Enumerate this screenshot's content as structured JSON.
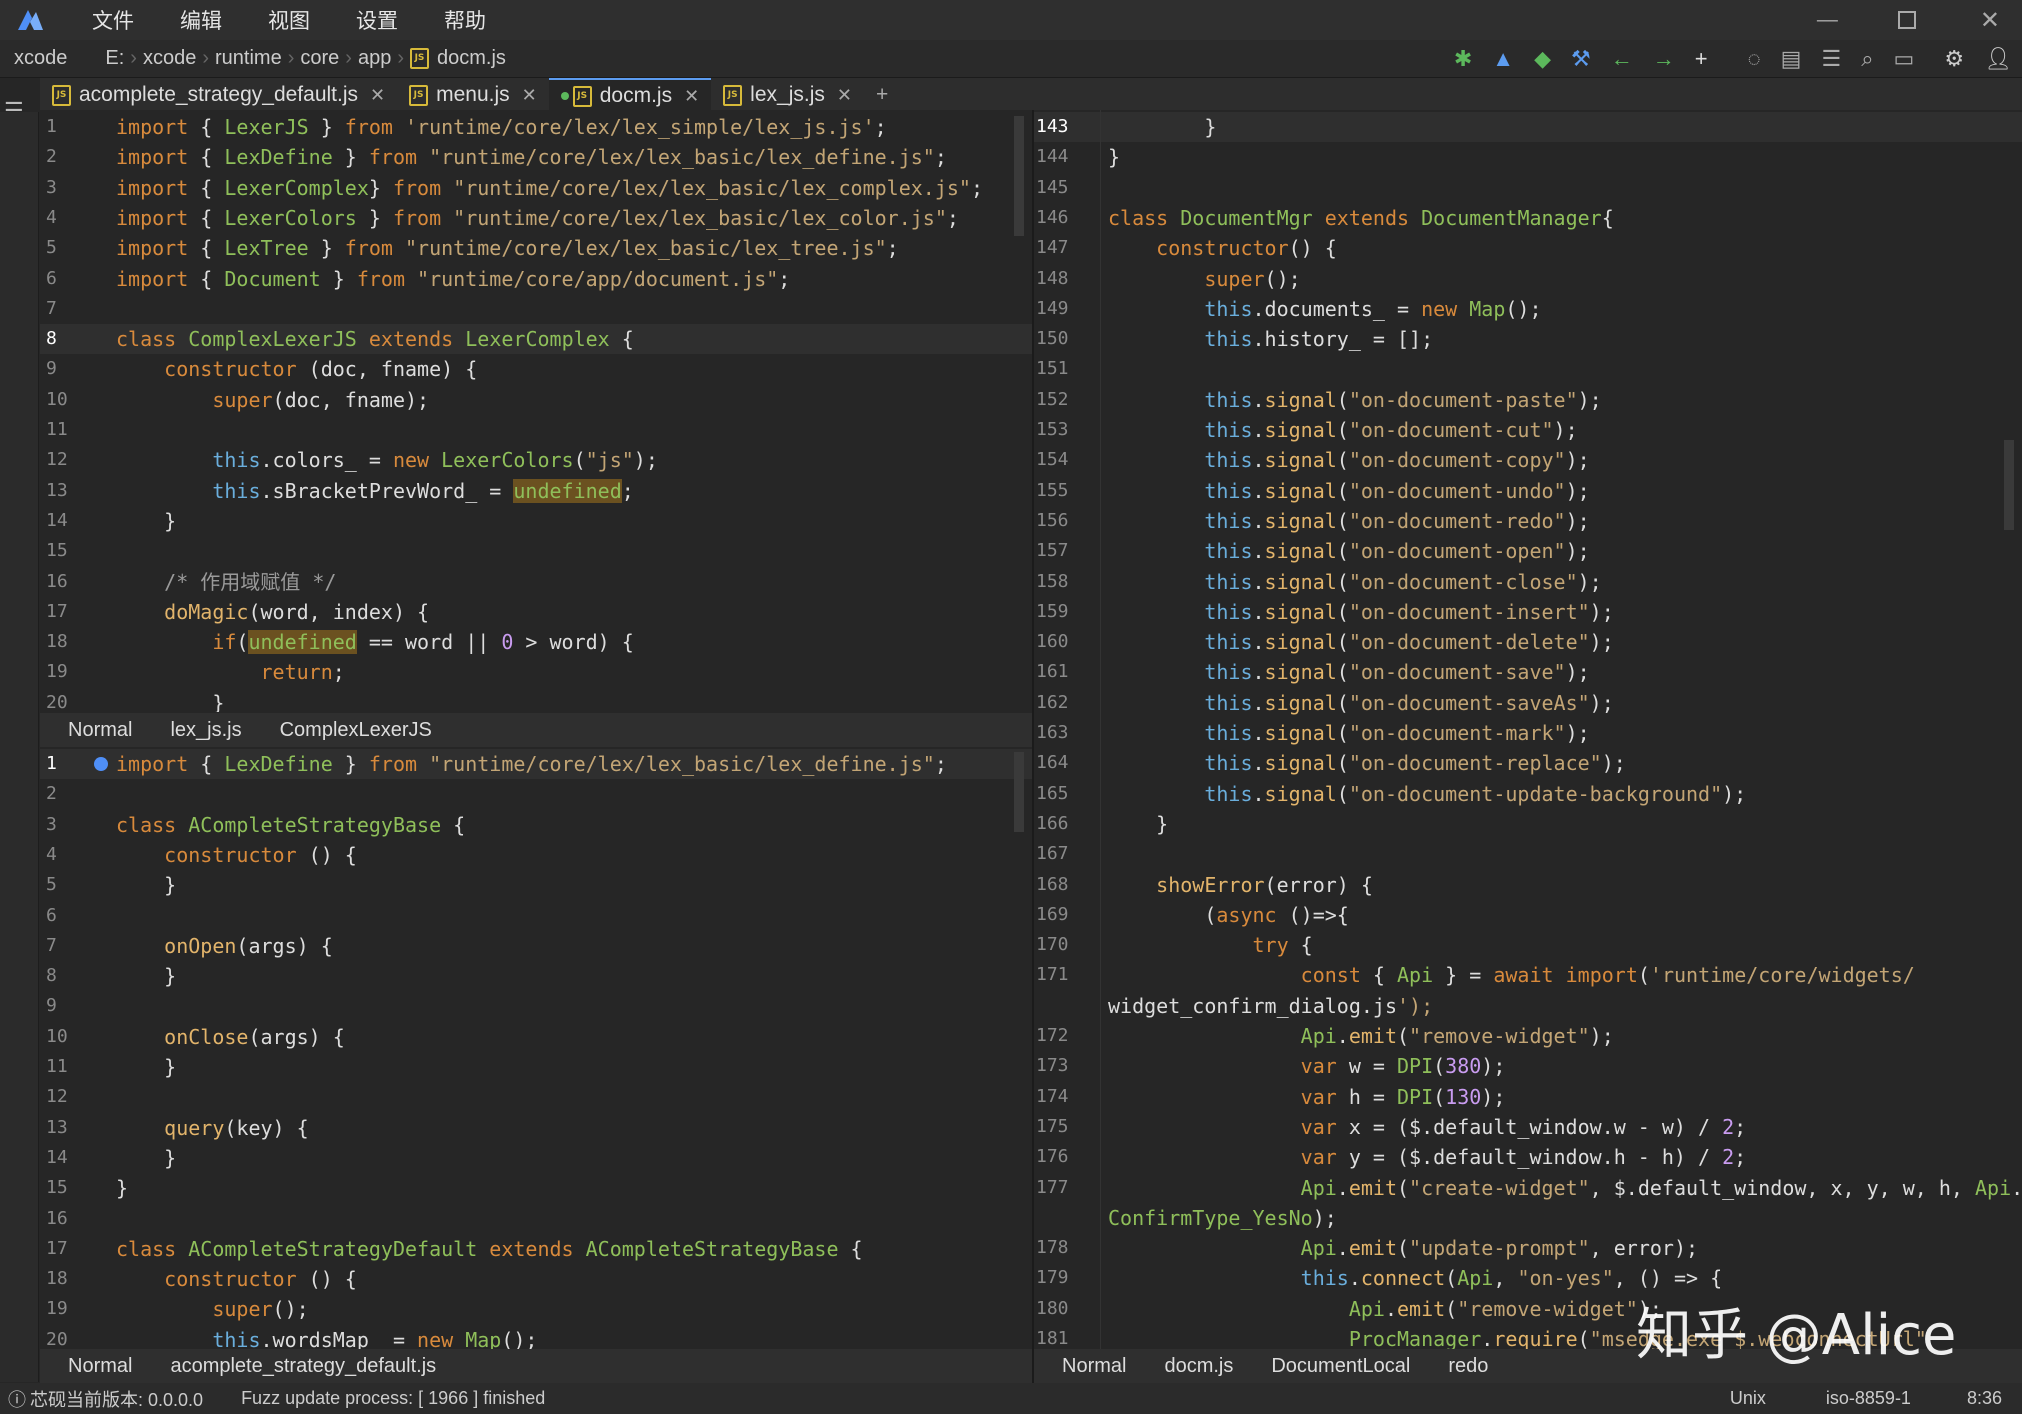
{
  "menubar": {
    "items": [
      "文件",
      "编辑",
      "视图",
      "设置",
      "帮助"
    ]
  },
  "path": {
    "items": [
      "xcode",
      "E:",
      "xcode",
      "runtime",
      "core",
      "app",
      "docm.js"
    ]
  },
  "tabs": [
    {
      "label": "acomplete_strategy_default.js"
    },
    {
      "label": "menu.js"
    },
    {
      "label": "docm.js"
    },
    {
      "label": "lex_js.js"
    }
  ],
  "tab_add": "+",
  "status_tl": {
    "mode": "Normal",
    "file": "lex_js.js",
    "context": "ComplexLexerJS"
  },
  "status_bl": {
    "mode": "Normal",
    "file": "acomplete_strategy_default.js"
  },
  "status_r": {
    "mode": "Normal",
    "file": "docm.js",
    "context": "DocumentLocal",
    "func": "redo"
  },
  "bottom": {
    "version": "芯砚当前版本: 0.0.0.0",
    "process": "Fuzz update process: [ 1966 ] finished",
    "eol": "Unix",
    "encoding": "iso-8859-1",
    "time": "8:36"
  },
  "watermark": "知乎 @Alice",
  "colors": {
    "keyword": "#d88a3c",
    "type": "#8fbf5a",
    "string": "#c3a575",
    "this": "#6aaedc",
    "function": "#e2b46b"
  },
  "pane_tl": [
    {
      "n": "1",
      "t": "import { LexerJS } from 'runtime/core/lex/lex_simple/lex_js.js';"
    },
    {
      "n": "2",
      "t": "import { LexDefine } from \"runtime/core/lex/lex_basic/lex_define.js\";"
    },
    {
      "n": "3",
      "t": "import { LexerComplex} from \"runtime/core/lex/lex_basic/lex_complex.js\";"
    },
    {
      "n": "4",
      "t": "import { LexerColors } from \"runtime/core/lex/lex_basic/lex_color.js\";"
    },
    {
      "n": "5",
      "t": "import { LexTree } from \"runtime/core/lex/lex_basic/lex_tree.js\";"
    },
    {
      "n": "6",
      "t": "import { Document } from \"runtime/core/app/document.js\";"
    },
    {
      "n": "7",
      "t": ""
    },
    {
      "n": "8",
      "t": "class ComplexLexerJS extends LexerComplex {"
    },
    {
      "n": "9",
      "t": "    constructor (doc, fname) {"
    },
    {
      "n": "10",
      "t": "        super(doc, fname);"
    },
    {
      "n": "11",
      "t": ""
    },
    {
      "n": "12",
      "t": "        this.colors_ = new LexerColors(\"js\");"
    },
    {
      "n": "13",
      "t": "        this.sBracketPrevWord_ = undefined;"
    },
    {
      "n": "14",
      "t": "    }"
    },
    {
      "n": "15",
      "t": ""
    },
    {
      "n": "16",
      "t": "    /* 作用域赋值 */"
    },
    {
      "n": "17",
      "t": "    doMagic(word, index) {"
    },
    {
      "n": "18",
      "t": "        if(undefined == word || 0 > word) {"
    },
    {
      "n": "19",
      "t": "            return;"
    },
    {
      "n": "20",
      "t": "        }"
    }
  ],
  "pane_bl": [
    {
      "n": "1",
      "t": "import { LexDefine } from \"runtime/core/lex/lex_basic/lex_define.js\";"
    },
    {
      "n": "2",
      "t": ""
    },
    {
      "n": "3",
      "t": "class ACompleteStrategyBase {"
    },
    {
      "n": "4",
      "t": "    constructor () {"
    },
    {
      "n": "5",
      "t": "    }"
    },
    {
      "n": "6",
      "t": ""
    },
    {
      "n": "7",
      "t": "    onOpen(args) {"
    },
    {
      "n": "8",
      "t": "    }"
    },
    {
      "n": "9",
      "t": ""
    },
    {
      "n": "10",
      "t": "    onClose(args) {"
    },
    {
      "n": "11",
      "t": "    }"
    },
    {
      "n": "12",
      "t": ""
    },
    {
      "n": "13",
      "t": "    query(key) {"
    },
    {
      "n": "14",
      "t": "    }"
    },
    {
      "n": "15",
      "t": "}"
    },
    {
      "n": "16",
      "t": ""
    },
    {
      "n": "17",
      "t": "class ACompleteStrategyDefault extends ACompleteStrategyBase {"
    },
    {
      "n": "18",
      "t": "    constructor () {"
    },
    {
      "n": "19",
      "t": "        super();"
    },
    {
      "n": "20",
      "t": "        this.wordsMap_ = new Map();"
    }
  ],
  "pane_r": [
    {
      "n": "143",
      "t": "        }"
    },
    {
      "n": "144",
      "t": "}"
    },
    {
      "n": "145",
      "t": ""
    },
    {
      "n": "146",
      "t": "class DocumentMgr extends DocumentManager{"
    },
    {
      "n": "147",
      "t": "    constructor() {"
    },
    {
      "n": "148",
      "t": "        super();"
    },
    {
      "n": "149",
      "t": "        this.documents_ = new Map();"
    },
    {
      "n": "150",
      "t": "        this.history_ = [];"
    },
    {
      "n": "151",
      "t": ""
    },
    {
      "n": "152",
      "t": "        this.signal(\"on-document-paste\");"
    },
    {
      "n": "153",
      "t": "        this.signal(\"on-document-cut\");"
    },
    {
      "n": "154",
      "t": "        this.signal(\"on-document-copy\");"
    },
    {
      "n": "155",
      "t": "        this.signal(\"on-document-undo\");"
    },
    {
      "n": "156",
      "t": "        this.signal(\"on-document-redo\");"
    },
    {
      "n": "157",
      "t": "        this.signal(\"on-document-open\");"
    },
    {
      "n": "158",
      "t": "        this.signal(\"on-document-close\");"
    },
    {
      "n": "159",
      "t": "        this.signal(\"on-document-insert\");"
    },
    {
      "n": "160",
      "t": "        this.signal(\"on-document-delete\");"
    },
    {
      "n": "161",
      "t": "        this.signal(\"on-document-save\");"
    },
    {
      "n": "162",
      "t": "        this.signal(\"on-document-saveAs\");"
    },
    {
      "n": "163",
      "t": "        this.signal(\"on-document-mark\");"
    },
    {
      "n": "164",
      "t": "        this.signal(\"on-document-replace\");"
    },
    {
      "n": "165",
      "t": "        this.signal(\"on-document-update-background\");"
    },
    {
      "n": "166",
      "t": "    }"
    },
    {
      "n": "167",
      "t": ""
    },
    {
      "n": "168",
      "t": "    showError(error) {"
    },
    {
      "n": "169",
      "t": "        (async ()=>{"
    },
    {
      "n": "170",
      "t": "            try {"
    },
    {
      "n": "171",
      "t": "                const { Api } = await import('runtime/core/widgets/"
    },
    {
      "n": "",
      "t": "widget_confirm_dialog.js');"
    },
    {
      "n": "172",
      "t": "                Api.emit(\"remove-widget\");"
    },
    {
      "n": "173",
      "t": "                var w = DPI(380);"
    },
    {
      "n": "174",
      "t": "                var h = DPI(130);"
    },
    {
      "n": "175",
      "t": "                var x = ($.default_window.w - w) / 2;"
    },
    {
      "n": "176",
      "t": "                var y = ($.default_window.h - h) / 2;"
    },
    {
      "n": "177",
      "t": "                Api.emit(\"create-widget\", $.default_window, x, y, w, h, Api."
    },
    {
      "n": "",
      "t": "ConfirmType_YesNo);"
    },
    {
      "n": "178",
      "t": "                Api.emit(\"update-prompt\", error);"
    },
    {
      "n": "179",
      "t": "                this.connect(Api, \"on-yes\", () => {"
    },
    {
      "n": "180",
      "t": "                    Api.emit(\"remove-widget\");"
    },
    {
      "n": "181",
      "t": "                    ProcManager.require(\"msedge.exe $.webconnectUrl\""
    }
  ]
}
